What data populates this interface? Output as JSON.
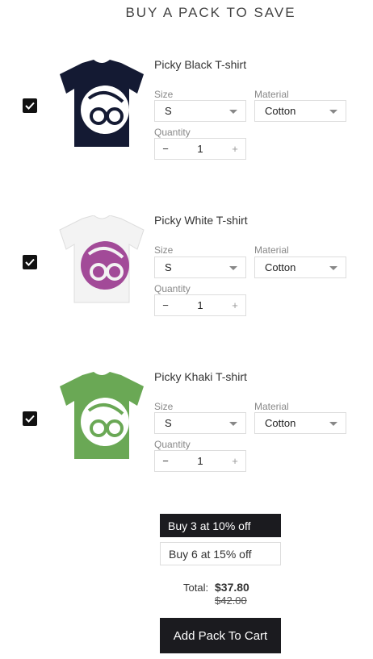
{
  "heading": "BUY A PACK TO SAVE",
  "labels": {
    "size": "Size",
    "material": "Material",
    "quantity": "Quantity"
  },
  "products": [
    {
      "name": "Picky Black T-shirt",
      "checked": true,
      "size": "S",
      "material": "Cotton",
      "quantity": "1",
      "shirt_color": "#141a33",
      "graphic_color": "#ffffff"
    },
    {
      "name": "Picky White T-shirt",
      "checked": true,
      "size": "S",
      "material": "Cotton",
      "quantity": "1",
      "shirt_color": "#f3f3f3",
      "graphic_color": "#a24a98"
    },
    {
      "name": "Picky Khaki T-shirt",
      "checked": true,
      "size": "S",
      "material": "Cotton",
      "quantity": "1",
      "shirt_color": "#6aa855",
      "graphic_color": "#ffffff"
    }
  ],
  "qty_minus": "−",
  "qty_plus": "+",
  "offers": [
    {
      "label": "Buy 3 at 10% off",
      "selected": true
    },
    {
      "label": "Buy 6 at 15% off",
      "selected": false
    }
  ],
  "total_label": "Total:",
  "total_price": "$37.80",
  "old_price": "$42.00",
  "add_button": "Add Pack To Cart",
  "icons": {
    "check": "checkmark-icon",
    "caret": "chevron-down-icon",
    "shirt": "tshirt-icon"
  }
}
